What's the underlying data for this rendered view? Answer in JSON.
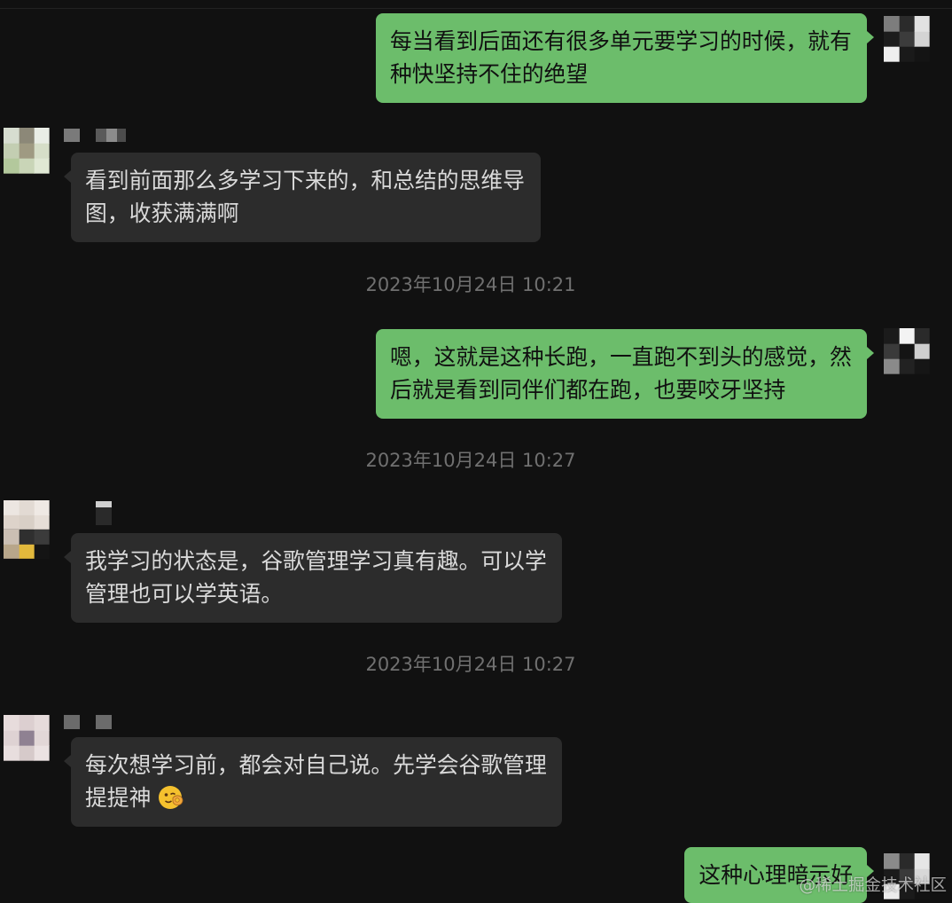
{
  "colors": {
    "background": "#111111",
    "outgoing_bubble": "#6cbd6b",
    "outgoing_text": "#101010",
    "incoming_bubble": "#2c2c2c",
    "incoming_text": "#dadada",
    "timestamp_text": "#707070"
  },
  "chat": {
    "items": [
      {
        "outgoing": true,
        "avatar_icon": "pixelated-avatar-icon",
        "text": "每当看到后面还有很多单元要学习的时候，就有种快坚持不住的绝望"
      },
      {
        "outgoing": false,
        "avatar_icon": "pixelated-avatar-icon",
        "name_icon": "pixelated-name-icon",
        "text": "看到前面那么多学习下来的，和总结的思维导图，收获满满啊"
      },
      {
        "timestamp": "2023年10月24日 10:21"
      },
      {
        "outgoing": true,
        "avatar_icon": "pixelated-avatar-icon",
        "text": "嗯，这就是这种长跑，一直跑不到头的感觉，然后就是看到同伴们都在跑，也要咬牙坚持"
      },
      {
        "timestamp": "2023年10月24日 10:27"
      },
      {
        "outgoing": false,
        "avatar_icon": "pixelated-avatar-icon",
        "name_icon": "pixelated-name-icon",
        "text": "我学习的状态是，谷歌管理学习真有趣。可以学管理也可以学英语。"
      },
      {
        "timestamp": "2023年10月24日 10:27"
      },
      {
        "outgoing": false,
        "avatar_icon": "pixelated-avatar-icon",
        "name_icon": "pixelated-name-icon",
        "text": "每次想学习前，都会对自己说。先学会谷歌管理提提神",
        "emoji_icon": "peeking-face-emoji-icon"
      },
      {
        "outgoing": true,
        "avatar_icon": "pixelated-avatar-icon",
        "text": "这种心理暗示好"
      }
    ]
  },
  "watermark": {
    "text": "@稀土掘金技术社区"
  }
}
